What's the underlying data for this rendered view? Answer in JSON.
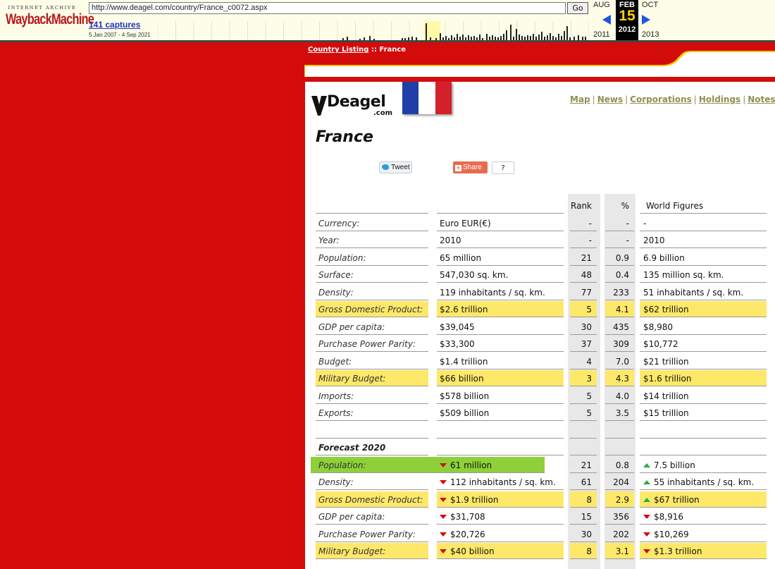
{
  "wayback": {
    "logo_top": "INTERNET ARCHIVE",
    "logo_main": "WaybackMachine",
    "url": "http://www.deagel.com/country/France_c0072.aspx",
    "go_label": "Go",
    "captures": "141 captures",
    "range": "5 Jan 2007 - 4 Sep 2021",
    "prev_month": "AUG",
    "cur_month": "FEB",
    "next_month": "OCT",
    "cur_day": "15",
    "prev_year": "2011",
    "cur_year": "2012",
    "next_year": "2013"
  },
  "breadcrumb": {
    "link": "Country Listing",
    "sep": " :: ",
    "current": "France"
  },
  "logo": {
    "word": "Deagel",
    "suffix": ".com"
  },
  "nav": [
    "Map",
    "News",
    "Corporations",
    "Holdings",
    "Notes"
  ],
  "page_title": "France",
  "social": {
    "tweet": "Tweet",
    "share": "Share",
    "help": "?"
  },
  "colors": {
    "highlight": "#fde86a",
    "green": "#8ed03a",
    "background": "#d40b0b",
    "down": "#d40b0b",
    "up": "#2ea84a"
  },
  "table": {
    "headers": {
      "rank": "Rank",
      "pct": "%",
      "world": "World Figures"
    },
    "rows": [
      {
        "label": "Currency:",
        "value": "Euro EUR(€)",
        "rank": "-",
        "pct": "-",
        "world": "-"
      },
      {
        "label": "Year:",
        "value": "2010",
        "rank": "-",
        "pct": "-",
        "world": "2010"
      },
      {
        "label": "Population:",
        "value": "65 million",
        "rank": "21",
        "pct": "0.9",
        "world": "6.9 billion"
      },
      {
        "label": "Surface:",
        "value": "547,030 sq. km.",
        "rank": "48",
        "pct": "0.4",
        "world": "135 million sq. km."
      },
      {
        "label": "Density:",
        "value": "119 inhabitants / sq. km.",
        "rank": "77",
        "pct": "233",
        "world": "51 inhabitants / sq. km."
      },
      {
        "label": "Gross Domestic Product:",
        "value": "$2.6 trillion",
        "rank": "5",
        "pct": "4.1",
        "world": "$62 trillion"
      },
      {
        "label": "GDP per capita:",
        "value": "$39,045",
        "rank": "30",
        "pct": "435",
        "world": "$8,980"
      },
      {
        "label": "Purchase Power Parity:",
        "value": "$33,300",
        "rank": "37",
        "pct": "309",
        "world": "$10,772"
      },
      {
        "label": "Budget:",
        "value": "$1.4 trillion",
        "rank": "4",
        "pct": "7.0",
        "world": "$21 trillion"
      },
      {
        "label": "Military Budget:",
        "value": "$66 billion",
        "rank": "3",
        "pct": "4.3",
        "world": "$1.6 trillion"
      },
      {
        "label": "Imports:",
        "value": "$578 billion",
        "rank": "5",
        "pct": "4.0",
        "world": "$14 trillion"
      },
      {
        "label": "Exports:",
        "value": "$509 billion",
        "rank": "5",
        "pct": "3.5",
        "world": "$15 trillion"
      }
    ],
    "forecast_title": "Forecast 2020",
    "forecast": [
      {
        "label": "Population:",
        "value": "61 million",
        "rank": "21",
        "pct": "0.8",
        "world": "7.5 billion"
      },
      {
        "label": "Density:",
        "value": "112 inhabitants / sq. km.",
        "rank": "61",
        "pct": "204",
        "world": "55 inhabitants / sq. km."
      },
      {
        "label": "Gross Domestic Product:",
        "value": "$1.9 trillion",
        "rank": "8",
        "pct": "2.9",
        "world": "$67 trillion"
      },
      {
        "label": "GDP per capita:",
        "value": "$31,708",
        "rank": "15",
        "pct": "356",
        "world": "$8,916"
      },
      {
        "label": "Purchase Power Parity:",
        "value": "$20,726",
        "rank": "30",
        "pct": "202",
        "world": "$10,269"
      },
      {
        "label": "Military Budget:",
        "value": "$40 billion",
        "rank": "8",
        "pct": "3.1",
        "world": "$1.3 trillion"
      }
    ]
  }
}
